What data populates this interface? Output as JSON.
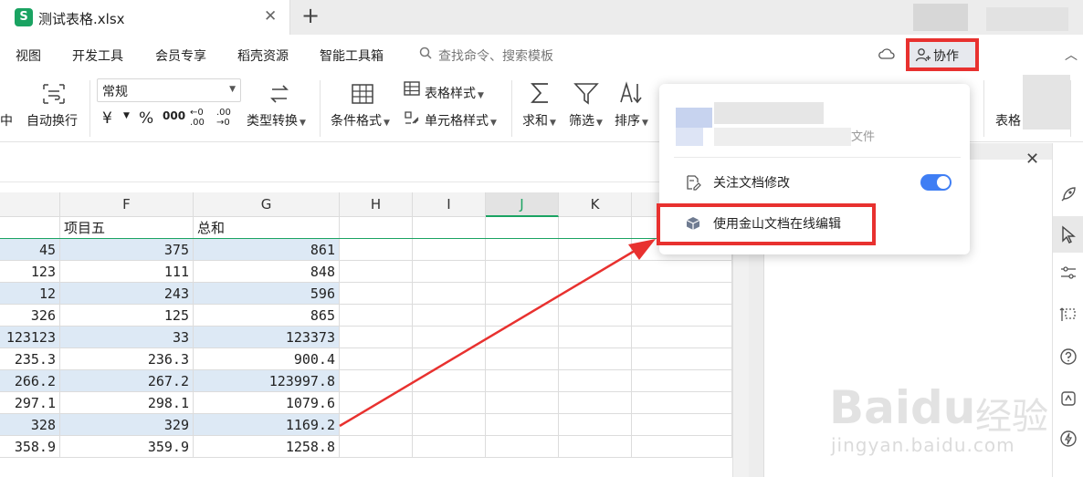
{
  "tab": {
    "logo": "S",
    "title": "测试表格.xlsx",
    "close": "✕",
    "new": "+"
  },
  "menu": {
    "items": [
      "视图",
      "开发工具",
      "会员专享",
      "稻壳资源",
      "智能工具箱"
    ],
    "search_placeholder": "查找命令、搜索模板",
    "collab_label": "协作",
    "collapse": "︿"
  },
  "ribbon": {
    "left_partial": "中",
    "wrap_label": "自动换行",
    "number_format": "常规",
    "currency_symbol": "¥",
    "percent_symbol": "%",
    "thousands_symbol": "000",
    "dec_increase": "←0 .00",
    "dec_decrease": ".00 →0",
    "convert_label": "类型转换",
    "cond_format_label": "条件格式",
    "table_style_label": "表格样式",
    "cell_style_label": "单元格样式",
    "sum_label": "求和",
    "filter_label": "筛选",
    "sort_label": "排序",
    "right_partial": "表格"
  },
  "grid": {
    "columns": [
      "F",
      "G",
      "H",
      "I",
      "J",
      "K"
    ],
    "selected_column": "J",
    "header_row": [
      "",
      "项目五",
      "总和"
    ],
    "rows": [
      [
        "45",
        "375",
        "861"
      ],
      [
        "123",
        "111",
        "848"
      ],
      [
        "12",
        "243",
        "596"
      ],
      [
        "326",
        "125",
        "865"
      ],
      [
        "123123",
        "33",
        "123373"
      ],
      [
        "235.3",
        "236.3",
        "900.4"
      ],
      [
        "266.2",
        "267.2",
        "123997.8"
      ],
      [
        "297.1",
        "298.1",
        "1079.6"
      ],
      [
        "328",
        "329",
        "1169.2"
      ],
      [
        "358.9",
        "359.9",
        "1258.8"
      ]
    ]
  },
  "popup": {
    "user_suffix": "文件",
    "follow_label": "关注文档修改",
    "follow_enabled": true,
    "online_edit_label": "使用金山文档在线编辑"
  },
  "panel": {
    "close": "✕"
  },
  "watermark": {
    "logo": "Baidu",
    "cn": "经验",
    "url": "jingyan.baidu.com"
  },
  "colors": {
    "accent": "#1aa362",
    "highlight": "#e8312f",
    "toggle": "#3f7ef4",
    "band": "#dde9f5"
  }
}
